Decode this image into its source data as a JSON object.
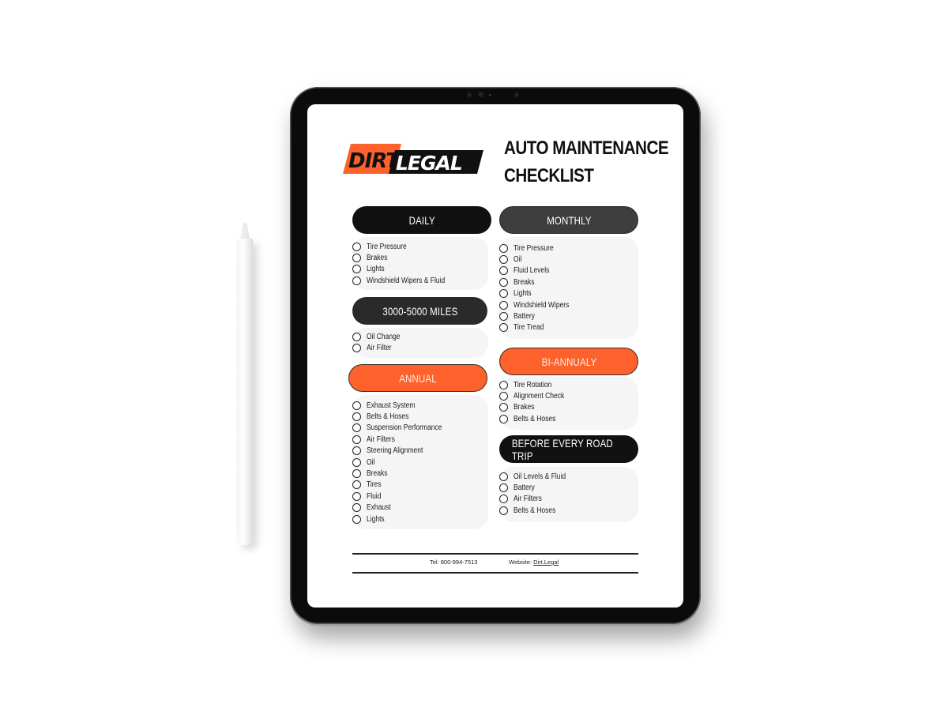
{
  "document": {
    "brand": {
      "part1": "DIRT",
      "part2": "LEGAL",
      "accent_color": "#fd612c"
    },
    "title_line1": "AUTO MAINTENANCE",
    "title_line2": "CHECKLIST",
    "sections": {
      "daily": {
        "label": "DAILY",
        "items": [
          "Tire Pressure",
          "Brakes",
          "Lights",
          "Windshield Wipers & Fluid"
        ]
      },
      "miles": {
        "label": "3000-5000 MILES",
        "items": [
          "Oil Change",
          "Air Filter"
        ]
      },
      "annual": {
        "label": "ANNUAL",
        "items": [
          "Exhaust System",
          "Belts & Hoses",
          "Suspension Performance",
          "Air Filters",
          "Steering Alignment",
          "Oil",
          "Breaks",
          "Tires",
          "Fluid",
          "Exhaust",
          "Lights"
        ]
      },
      "monthly": {
        "label": "MONTHLY",
        "items": [
          "Tire Pressure",
          "Oil",
          "Fluid Levels",
          "Breaks",
          "Lights",
          "Windshield Wipers",
          "Battery",
          "Tire Tread"
        ]
      },
      "biannual": {
        "label": "BI-ANNUALY",
        "items": [
          "Tire Rotation",
          "Alignment Check",
          "Brakes",
          "Belts & Hoses"
        ]
      },
      "roadtrip": {
        "label": "BEFORE EVERY ROAD TRIP",
        "items": [
          "Oil Levels & Fluid",
          "Battery",
          "Air Filters",
          "Belts & Hoses"
        ]
      }
    },
    "footer": {
      "tel_label": "Tel: 800-994-7513",
      "website_label": "Website:",
      "website_link": "Dirt.Legal"
    }
  },
  "colors": {
    "orange": "#fd612c",
    "black": "#111111",
    "dark_gray": "#3e3e3e",
    "list_bg": "#f5f5f5"
  }
}
